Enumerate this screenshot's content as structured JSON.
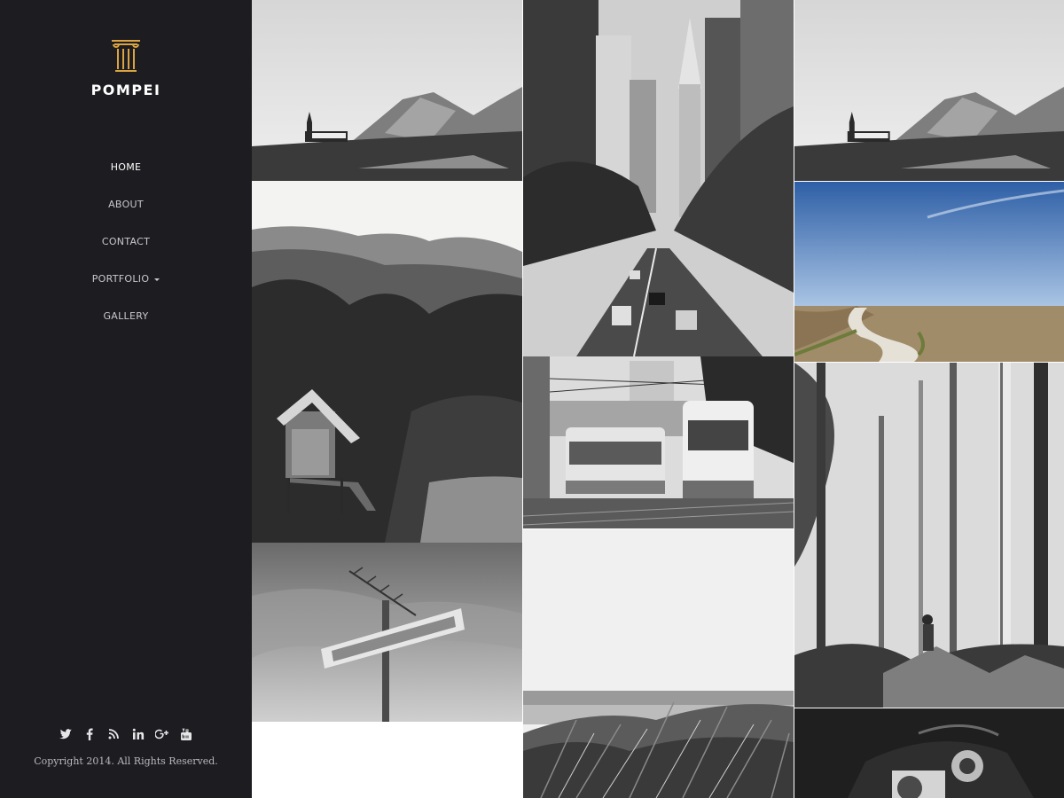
{
  "brand": {
    "name": "POMPEI",
    "icon": "column-icon",
    "accent": "#d9a441"
  },
  "nav": {
    "items": [
      {
        "label": "HOME",
        "active": true
      },
      {
        "label": "ABOUT",
        "active": false
      },
      {
        "label": "CONTACT",
        "active": false
      },
      {
        "label": "PORTFOLIO",
        "active": false,
        "has_dropdown": true
      },
      {
        "label": "GALLERY",
        "active": false
      }
    ]
  },
  "social": [
    "twitter-icon",
    "facebook-icon",
    "rss-icon",
    "linkedin-icon",
    "google-plus-icon",
    "youtube-icon"
  ],
  "footer": {
    "copyright": "Copyright 2014. All Rights Reserved."
  },
  "gallery": {
    "images": [
      "church-mountain",
      "city-street",
      "church-mountain",
      "wooden-shed-forest",
      "field-road",
      "tram-street",
      "motel-sign",
      "misty-forest",
      "beach-grass",
      "camera-closeup"
    ]
  },
  "colors": {
    "sidebar_bg": "#1c1c21",
    "nav_active": "#ffffff",
    "nav_text": "#c9c9cc"
  }
}
